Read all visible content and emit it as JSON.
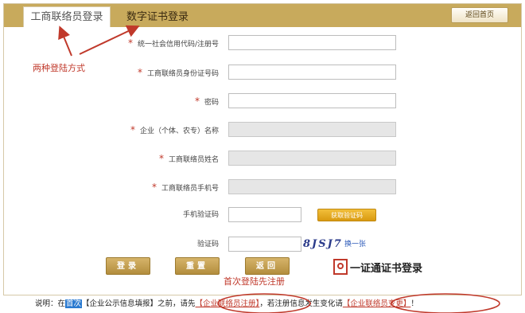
{
  "tabs": {
    "active": "工商联络员登录",
    "inactive": "数字证书登录"
  },
  "header": {
    "home_button": "返回首页"
  },
  "form": {
    "fields": [
      {
        "label": "统一社会信用代码/注册号",
        "required": true,
        "disabled": false,
        "value": ""
      },
      {
        "label": "工商联络员身份证号码",
        "required": true,
        "disabled": false,
        "value": ""
      },
      {
        "label": "密码",
        "required": true,
        "disabled": false,
        "value": ""
      },
      {
        "label": "企业（个体、农专）名称",
        "required": true,
        "disabled": true,
        "value": ""
      },
      {
        "label": "工商联络员姓名",
        "required": true,
        "disabled": true,
        "value": ""
      },
      {
        "label": "工商联络员手机号",
        "required": true,
        "disabled": true,
        "value": ""
      }
    ],
    "sms": {
      "label": "手机验证码",
      "button": "获取验证码"
    },
    "captcha": {
      "label": "验证码",
      "image_text": "8JSJ7",
      "refresh": "换一张"
    },
    "buttons": {
      "login": "登录",
      "reset": "重置",
      "back": "返回"
    },
    "cert_login": "一证通证书登录"
  },
  "annotations": {
    "login_methods": "两种登陆方式",
    "register_first": "首次登陆先注册"
  },
  "footer": {
    "prefix": "说明：在",
    "highlight": "首次",
    "mid1": "【企业公示信息填报】之前，请先",
    "link_register": "【企业联络员注册】",
    "mid2": "，若注册信息发生变化请",
    "link_change": "【企业联络员变更】",
    "suffix": "！"
  },
  "colors": {
    "accent": "#c8aa5c",
    "annotation": "#c0392b",
    "button_orange": "#e0a21a"
  }
}
